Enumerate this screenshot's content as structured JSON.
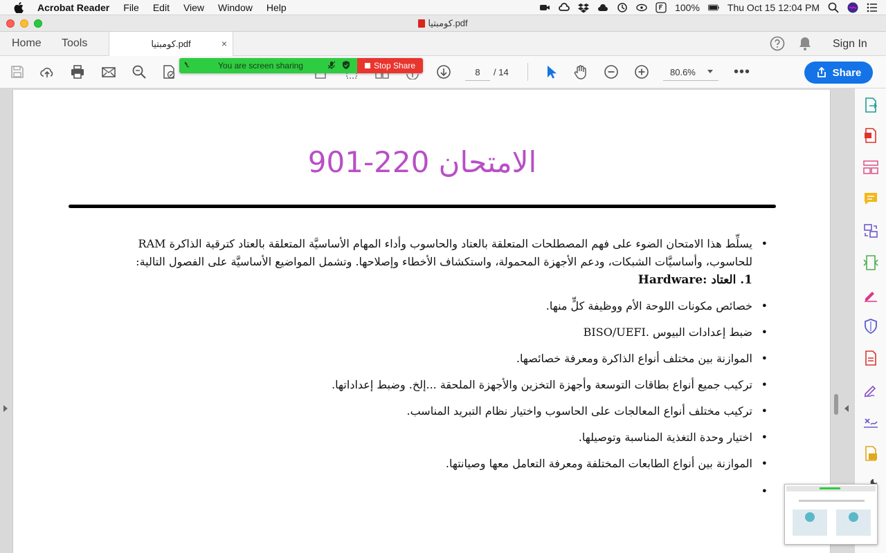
{
  "menubar": {
    "app_name": "Acrobat Reader",
    "items": [
      "File",
      "Edit",
      "View",
      "Window",
      "Help"
    ],
    "battery": "100%",
    "clock": "Thu Oct 15  12:04 PM"
  },
  "window": {
    "title": "كومبتيا.pdf"
  },
  "tabs": {
    "home": "Home",
    "tools": "Tools",
    "doc_tab": "كومبتيا.pdf",
    "close": "×",
    "sign_in": "Sign In"
  },
  "toolbar": {
    "page_current": "8",
    "page_total": "/  14",
    "zoom": "80.6%",
    "more": "•••",
    "share_label": "Share"
  },
  "screen_share": {
    "message": "You are screen sharing",
    "stop_label": "Stop Share"
  },
  "document": {
    "title": "الامتحان 220-901",
    "intro": "يسلِّط هذا الامتحان الضوء على فهم المصطلحات المتعلقة بالعتاد والحاسوب وأداء المهام الأساسيَّة المتعلقة بالعتاد كترقية الذاكرة RAM للحاسوب، وأساسيَّات الشبكات، ودعم الأجهزة المحمولة، واستكشاف الأخطاء وإصلاحها. وتشمل المواضيع الأساسيَّة على الفصول التالية:",
    "section_heading": "1. العتاد :Hardware",
    "bullets": [
      "خصائص مكونات اللوحة الأم ووظيفة كلٍّ منها.",
      "ضبط إعدادات البيوس .BISO/UEFI",
      "الموازنة بين مختلف أنواع الذاكرة ومعرفة خصائصها.",
      "تركيب جميع أنواع بطاقات التوسعة وأجهزة التخزين والأجهزة الملحقة ...إلخ. وضبط إعداداتها.",
      "تركيب مختلف أنواع المعالجات على الحاسوب واختيار نظام التبريد المناسب.",
      "اختيار وحدة التغذية المناسبة وتوصيلها.",
      "الموازنة بين أنواع الطابعات المختلفة ومعرفة التعامل معها وصيانتها.",
      ""
    ]
  },
  "colors": {
    "accent": "#1473e6",
    "title_purple": "#b84fc6",
    "share_green": "#2ecc40",
    "stop_red": "#e8352d"
  }
}
